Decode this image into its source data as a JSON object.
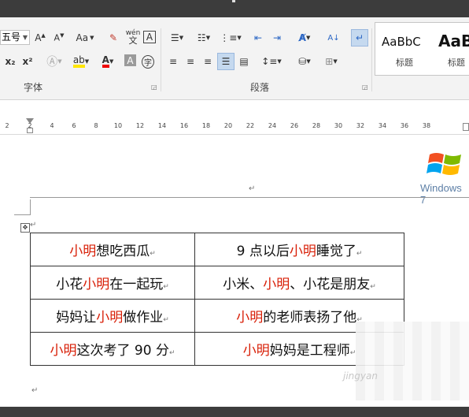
{
  "font_group": {
    "size_value": "五号",
    "label": "字体",
    "icons": [
      "grow-font-icon",
      "shrink-font-icon",
      "change-case-icon",
      "clear-format-icon",
      "phonetic-guide-icon",
      "char-border-icon",
      "subscript-icon",
      "superscript-icon",
      "text-effect-icon",
      "highlight-icon",
      "font-color-icon",
      "char-shading-icon",
      "enclose-char-icon"
    ],
    "case_label": "Aa",
    "sub_label": "x₂",
    "sup_label": "x²",
    "phonetic_top": "wén",
    "phonetic_bottom": "文",
    "border_label": "A",
    "shading_label": "A",
    "enclose_label": "字"
  },
  "paragraph_group": {
    "label": "段落"
  },
  "styles_group": {
    "items": [
      {
        "sample": "AaBbC",
        "name": "标题"
      },
      {
        "sample": "AaB",
        "name": "标题"
      }
    ]
  },
  "ruler": {
    "ticks": [
      "2",
      "2",
      "4",
      "6",
      "8",
      "10",
      "12",
      "14",
      "16",
      "18",
      "20",
      "22",
      "24",
      "26",
      "28",
      "30",
      "32",
      "34",
      "36",
      "38"
    ]
  },
  "document": {
    "paragraph_mark": "↵",
    "table_move_handle": "✥",
    "table": [
      [
        [
          {
            "t": "小明",
            "red": true
          },
          {
            "t": "想吃西瓜",
            "red": false
          }
        ],
        [
          {
            "t": "9 点以后",
            "red": false
          },
          {
            "t": "小明",
            "red": true
          },
          {
            "t": "睡觉了",
            "red": false
          }
        ]
      ],
      [
        [
          {
            "t": "小花",
            "red": false
          },
          {
            "t": "小明",
            "red": true
          },
          {
            "t": "在一起玩",
            "red": false
          }
        ],
        [
          {
            "t": "小米、",
            "red": false
          },
          {
            "t": "小明",
            "red": true
          },
          {
            "t": "、小花是朋友",
            "red": false
          }
        ]
      ],
      [
        [
          {
            "t": "妈妈让",
            "red": false
          },
          {
            "t": "小明",
            "red": true
          },
          {
            "t": "做作业",
            "red": false
          }
        ],
        [
          {
            "t": "小明",
            "red": true
          },
          {
            "t": "的老师表扬了他",
            "red": false
          }
        ]
      ],
      [
        [
          {
            "t": "小明",
            "red": true
          },
          {
            "t": "这次考了 90 分",
            "red": false
          }
        ],
        [
          {
            "t": "小明",
            "red": true
          },
          {
            "t": "妈妈是工程师",
            "red": false
          }
        ]
      ]
    ]
  },
  "overlay": {
    "windows_text": "Windows 7",
    "watermark": "jingyan"
  }
}
